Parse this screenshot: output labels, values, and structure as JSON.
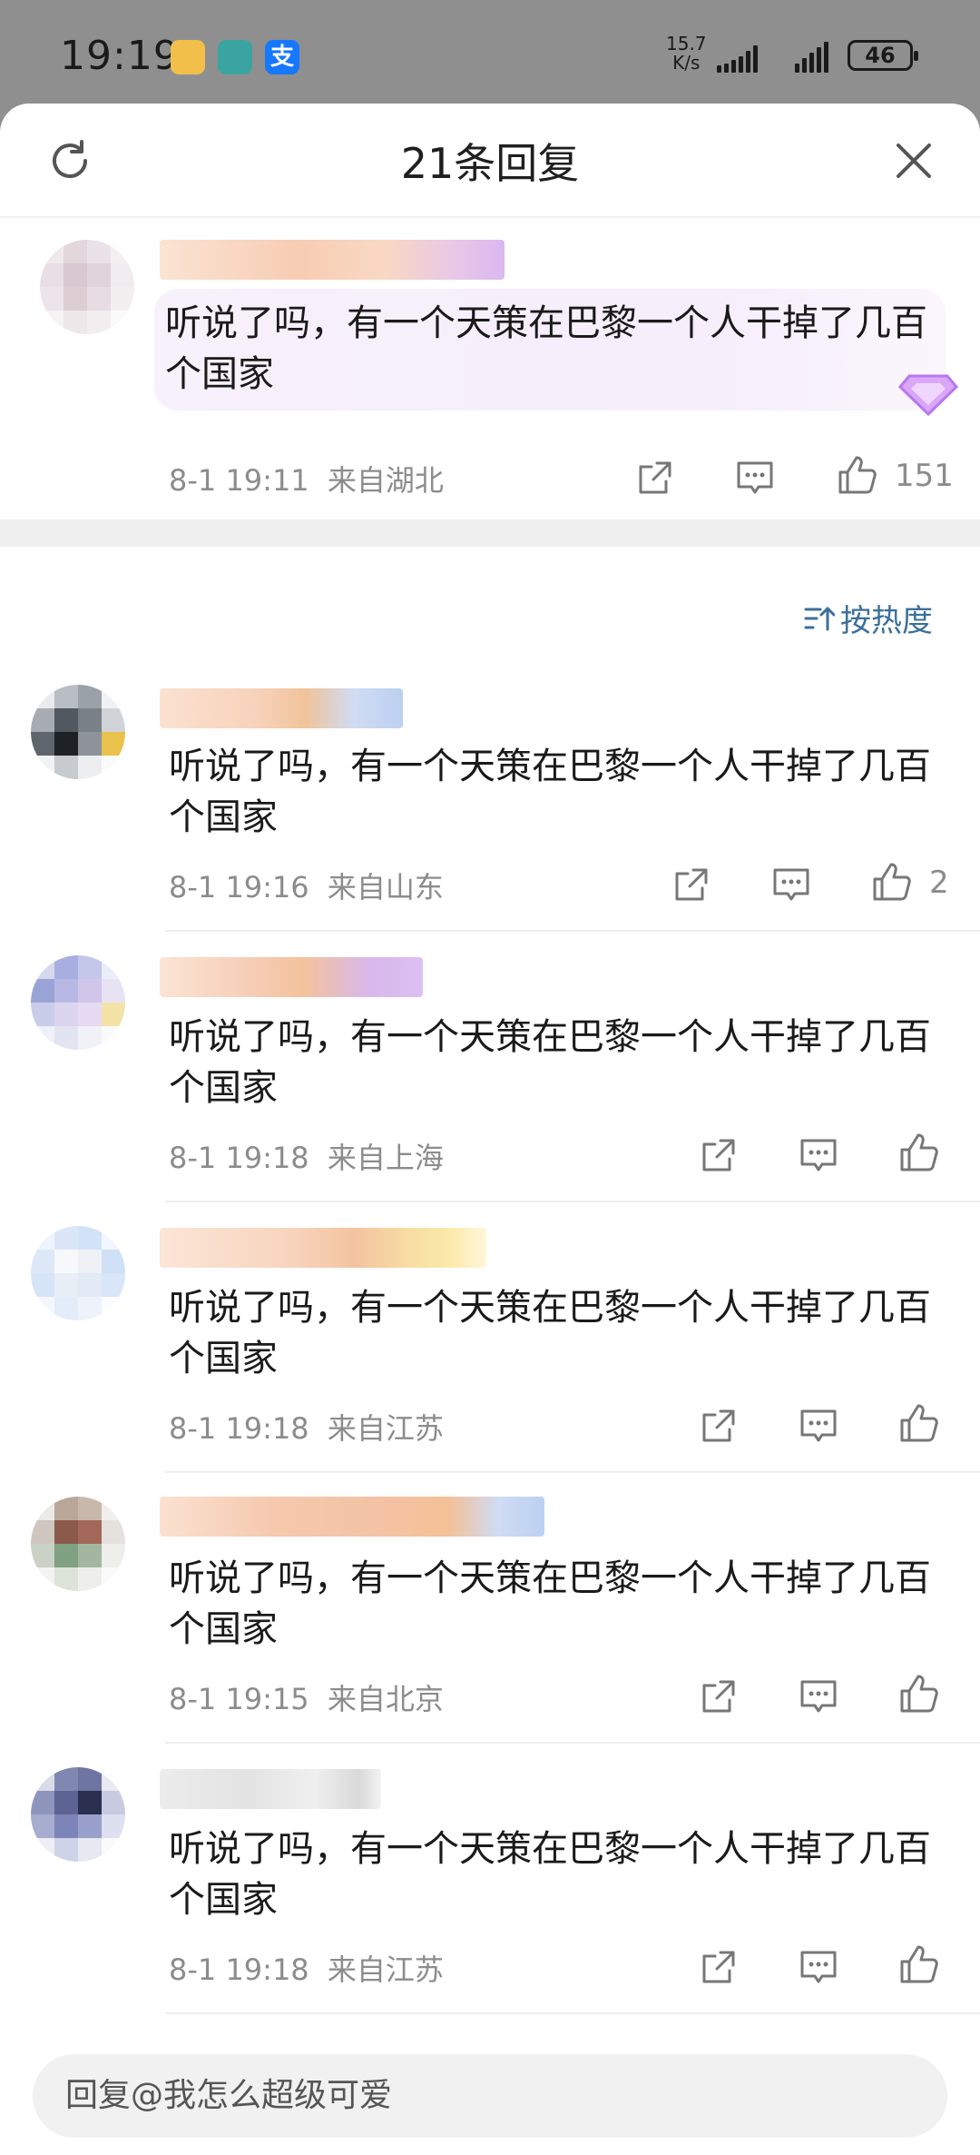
{
  "status_bar": {
    "time": "19:19",
    "net_speed_value": "15.7",
    "net_speed_unit": "K/s",
    "battery": "46",
    "alipay_glyph": "支"
  },
  "sheet": {
    "title": "21条回复",
    "refresh_icon": "refresh-icon",
    "close_icon": "close-icon"
  },
  "main_comment": {
    "text": "听说了吗，有一个天策在巴黎一个人干掉了几百个国家",
    "time": "8-1 19:11",
    "location": "来自湖北",
    "likes": "151"
  },
  "sort_label": "按热度",
  "replies": [
    {
      "text": "听说了吗，有一个天策在巴黎一个人干掉了几百个国家",
      "time": "8-1 19:16",
      "location": "来自山东",
      "likes": "2"
    },
    {
      "text": "听说了吗，有一个天策在巴黎一个人干掉了几百个国家",
      "time": "8-1 19:18",
      "location": "来自上海",
      "likes": ""
    },
    {
      "text": "听说了吗，有一个天策在巴黎一个人干掉了几百个国家",
      "time": "8-1 19:18",
      "location": "来自江苏",
      "likes": ""
    },
    {
      "text": "听说了吗，有一个天策在巴黎一个人干掉了几百个国家",
      "time": "8-1 19:15",
      "location": "来自北京",
      "likes": ""
    },
    {
      "text": "听说了吗，有一个天策在巴黎一个人干掉了几百个国家",
      "time": "8-1 19:18",
      "location": "来自江苏",
      "likes": ""
    }
  ],
  "reply_input": {
    "placeholder": "回复@我怎么超级可爱"
  },
  "colors": {
    "accent_link": "#3c6f99",
    "meta_gray": "#8c8c8c",
    "bubble_purple": "#f6eefb"
  }
}
